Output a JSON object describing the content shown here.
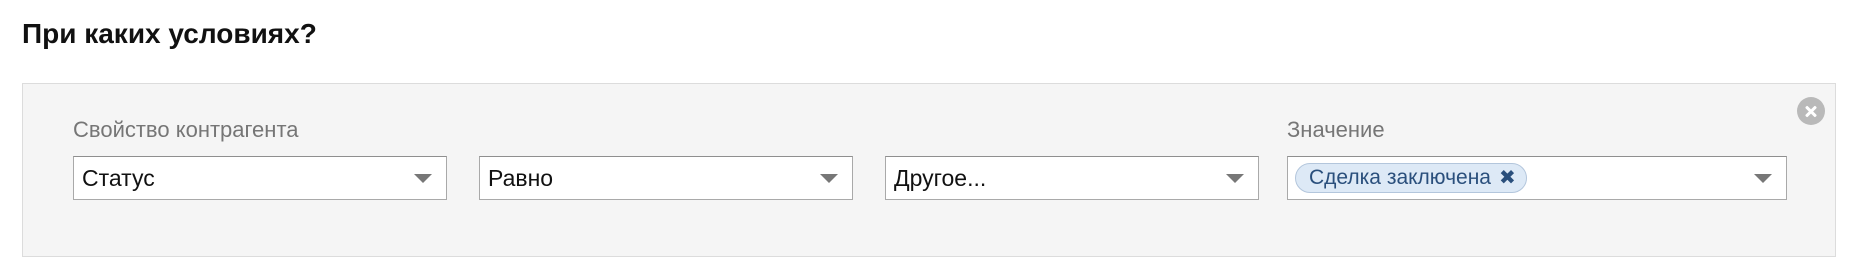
{
  "section": {
    "title": "При каких условиях?"
  },
  "condition": {
    "property_label": "Свойство контрагента",
    "value_label": "Значение",
    "property_select": {
      "selected": "Статус"
    },
    "operator_select": {
      "selected": "Равно"
    },
    "type_select": {
      "selected": "Другое..."
    },
    "value_select": {
      "tags": [
        {
          "label": "Сделка заключена",
          "remove_glyph": "✖"
        }
      ]
    },
    "remove_icon": "close-circle-icon"
  }
}
